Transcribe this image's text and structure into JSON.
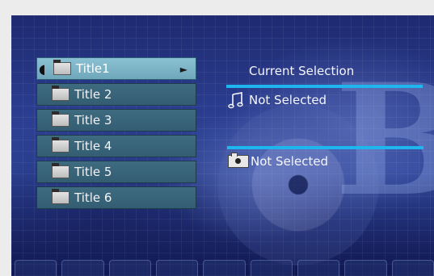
{
  "titles": [
    {
      "label": "Title1",
      "selected": true
    },
    {
      "label": "Title 2",
      "selected": false
    },
    {
      "label": "Title 3",
      "selected": false
    },
    {
      "label": "Title 4",
      "selected": false
    },
    {
      "label": "Title 5",
      "selected": false
    },
    {
      "label": "Title 6",
      "selected": false
    }
  ],
  "current_selection": {
    "header": "Current Selection",
    "audio_status": "Not Selected",
    "video_status": "Not Selected"
  },
  "icons": {
    "title_item": "folder-icon",
    "audio": "music-note-icon",
    "video": "camera-icon",
    "selected_marker": "play-arrow-icon"
  },
  "colors": {
    "selected_item": "#7fb5c8",
    "item": "#3a6579",
    "divider": "#1fb5ee",
    "background": "#2a3c8e"
  }
}
